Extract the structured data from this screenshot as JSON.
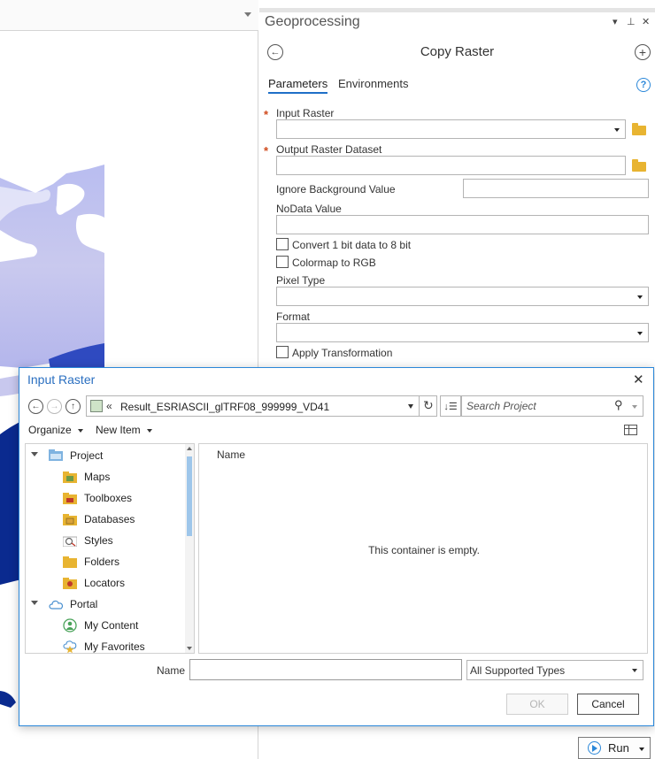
{
  "geoprocessing": {
    "pane_title": "Geoprocessing",
    "tool_title": "Copy Raster",
    "tabs": [
      "Parameters",
      "Environments"
    ],
    "help_glyph": "?",
    "parameters": {
      "input_raster_label": "Input Raster",
      "output_raster_label": "Output Raster Dataset",
      "ignore_background_label": "Ignore Background Value",
      "nodata_label": "NoData Value",
      "convert_1bit_label": "Convert 1 bit data to 8 bit",
      "colormap_label": "Colormap to RGB",
      "pixel_type_label": "Pixel Type",
      "format_label": "Format",
      "apply_transformation_label": "Apply Transformation"
    },
    "run_label": "Run"
  },
  "dialog": {
    "title": "Input Raster",
    "path_prefix": "«",
    "path": "Result_ESRIASCII_glTRF08_999999_VD41",
    "search_placeholder": "Search Project",
    "toolbar": {
      "organize": "Organize",
      "new_item": "New Item"
    },
    "tree": [
      {
        "label": "Project",
        "icon": "project-folder-icon",
        "level": 0,
        "expanded": true
      },
      {
        "label": "Maps",
        "icon": "maps-icon",
        "level": 1
      },
      {
        "label": "Toolboxes",
        "icon": "toolboxes-icon",
        "level": 1
      },
      {
        "label": "Databases",
        "icon": "databases-icon",
        "level": 1
      },
      {
        "label": "Styles",
        "icon": "styles-icon",
        "level": 1
      },
      {
        "label": "Folders",
        "icon": "folders-icon",
        "level": 1
      },
      {
        "label": "Locators",
        "icon": "locators-icon",
        "level": 1
      },
      {
        "label": "Portal",
        "icon": "portal-cloud-icon",
        "level": 0,
        "expanded": true
      },
      {
        "label": "My Content",
        "icon": "my-content-icon",
        "level": 1
      },
      {
        "label": "My Favorites",
        "icon": "my-favorites-icon",
        "level": 1
      }
    ],
    "column_header": "Name",
    "empty_message": "This container is empty.",
    "name_label": "Name",
    "name_value": "",
    "type_filter": "All Supported Types",
    "ok_label": "OK",
    "cancel_label": "Cancel"
  },
  "colors": {
    "accent": "#2a87d9",
    "dialog_title": "#2a6fc0",
    "required_star": "#d04a1c",
    "folder": "#e8b431"
  }
}
